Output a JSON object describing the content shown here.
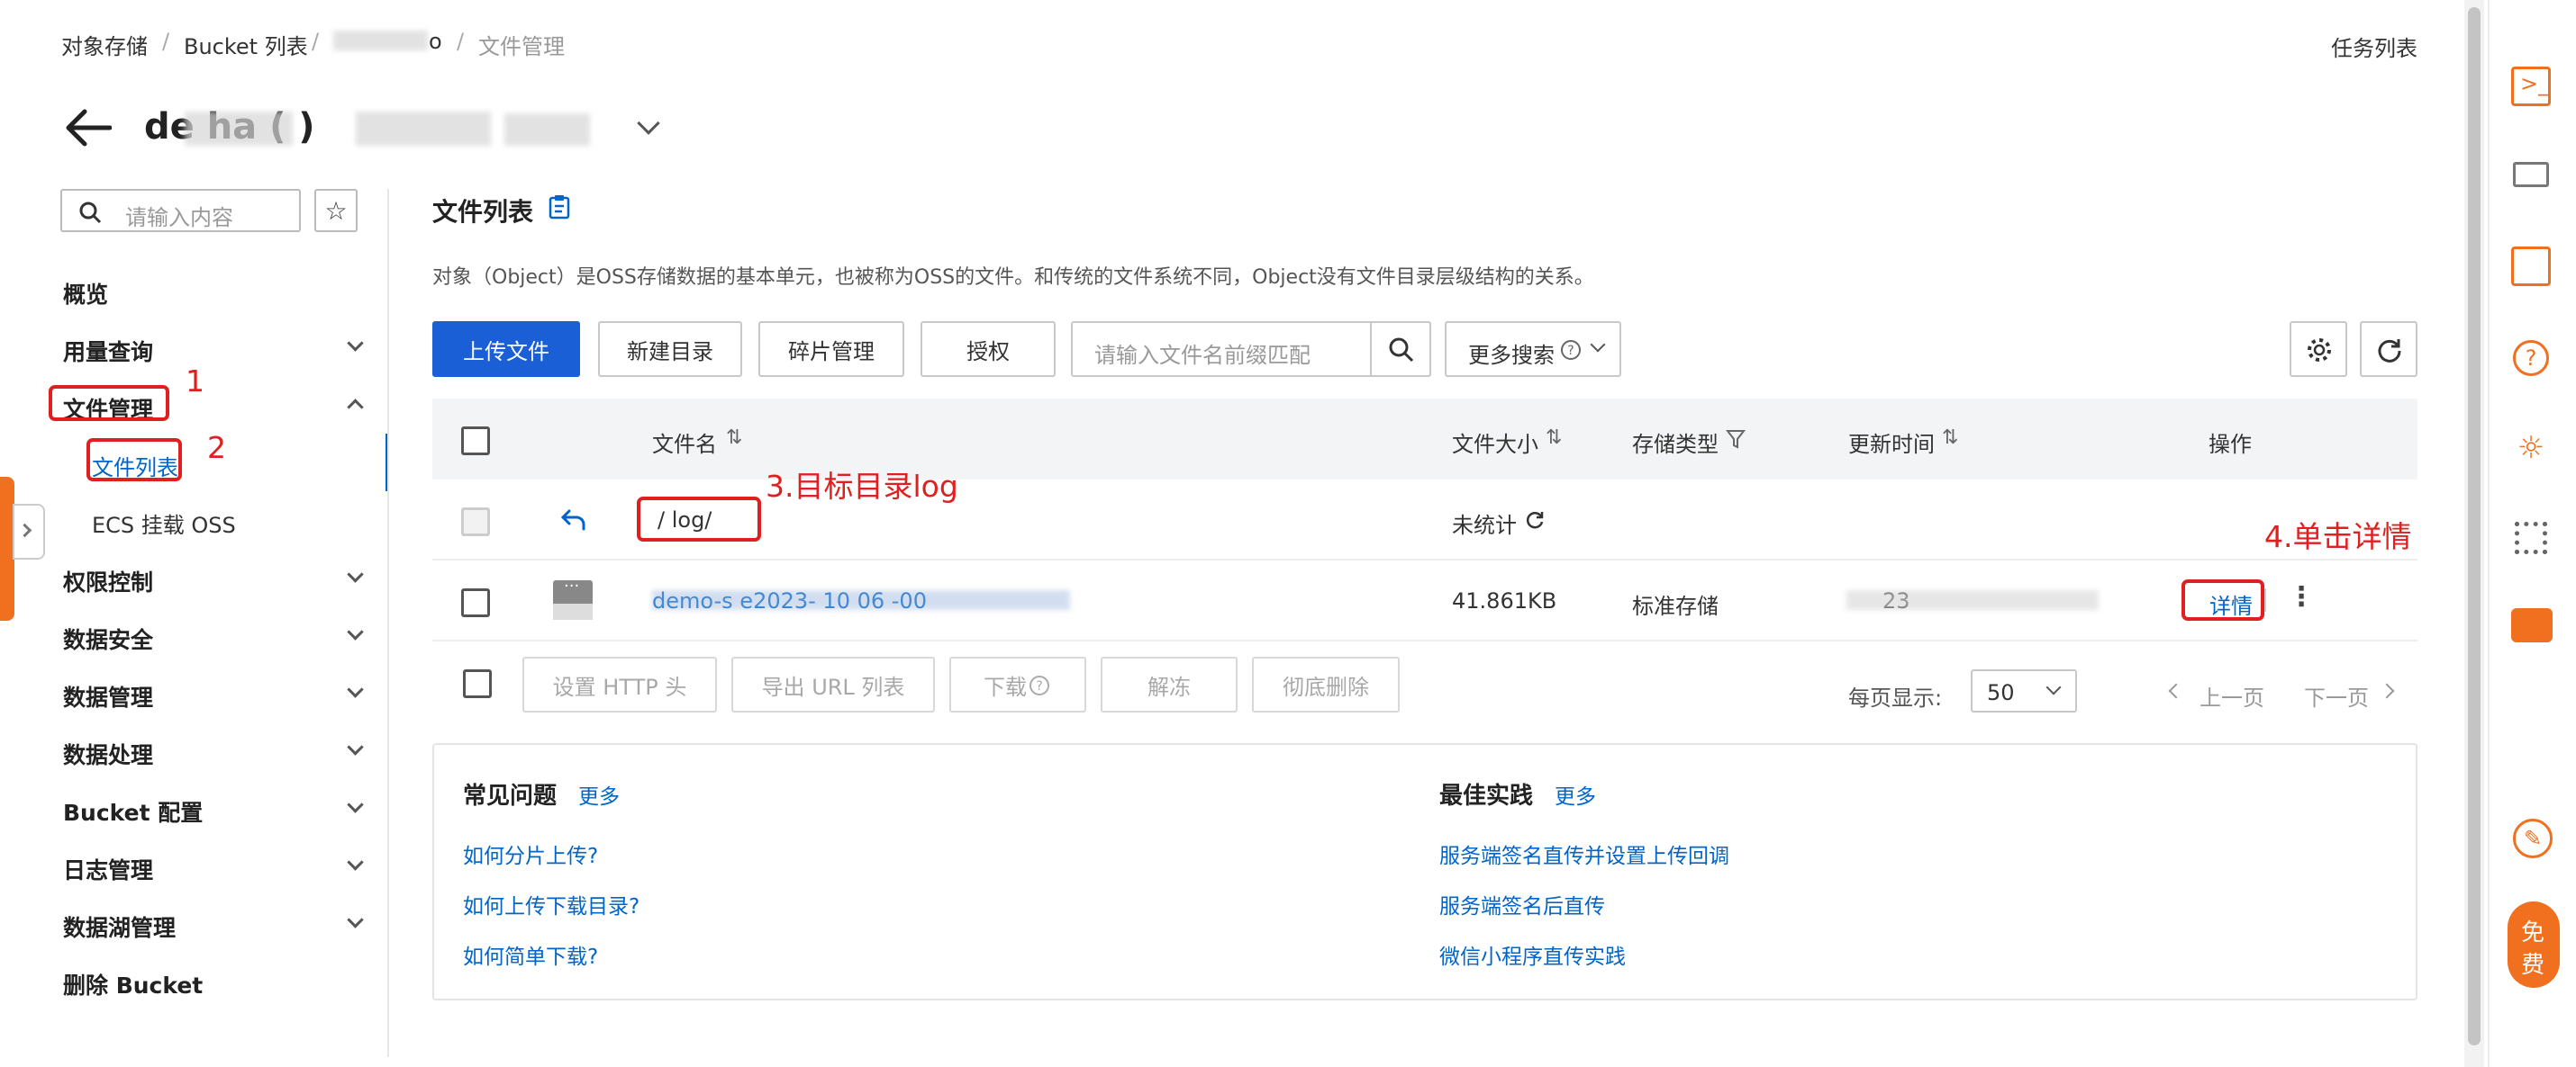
{
  "breadcrumb": {
    "item1": "对象存储",
    "sep": "/",
    "item2": "Bucket 列表",
    "item3": "o",
    "item4": "文件管理"
  },
  "task_list": "任务列表",
  "bucket_title": "de ha ( )",
  "sidebar": {
    "search_placeholder": "请输入内容",
    "items": [
      {
        "label": "概览"
      },
      {
        "label": "用量查询"
      },
      {
        "label": "文件管理"
      },
      {
        "label": "文件列表"
      },
      {
        "label": "ECS 挂载 OSS"
      },
      {
        "label": "权限控制"
      },
      {
        "label": "数据安全"
      },
      {
        "label": "数据管理"
      },
      {
        "label": "数据处理"
      },
      {
        "label": "Bucket 配置"
      },
      {
        "label": "日志管理"
      },
      {
        "label": "数据湖管理"
      },
      {
        "label": "删除 Bucket"
      }
    ]
  },
  "main": {
    "title": "文件列表",
    "description": "对象（Object）是OSS存储数据的基本单元，也被称为OSS的文件。和传统的文件系统不同，Object没有文件目录层级结构的关系。",
    "toolbar": {
      "upload": "上传文件",
      "new_dir": "新建目录",
      "fragment": "碎片管理",
      "authorize": "授权",
      "search_placeholder": "请输入文件名前缀匹配",
      "more_search": "更多搜索"
    },
    "table": {
      "headers": {
        "name": "文件名",
        "size": "文件大小",
        "storage": "存储类型",
        "updated": "更新时间",
        "actions": "操作"
      },
      "dir_row": {
        "name": "/  log/",
        "size": "未统计"
      },
      "file_row": {
        "name": "demo-s e2023- 10 06 -00",
        "size": "41.861KB",
        "storage": "标准存储",
        "updated": "23",
        "detail": "详情"
      }
    },
    "bulk": {
      "http_header": "设置 HTTP 头",
      "export_url": "导出 URL 列表",
      "download": "下载",
      "unfreeze": "解冻",
      "delete": "彻底删除"
    },
    "pager": {
      "label": "每页显示:",
      "size": "50",
      "prev": "上一页",
      "next": "下一页"
    },
    "faq": {
      "title": "常见问题",
      "more": "更多",
      "links": [
        "如何分片上传?",
        "如何上传下载目录?",
        "如何简单下载?"
      ]
    },
    "best": {
      "title": "最佳实践",
      "more": "更多",
      "links": [
        "服务端签名直传并设置上传回调",
        "服务端签名后直传",
        "微信小程序直传实践"
      ]
    }
  },
  "annotations": {
    "a1": "1",
    "a2": "2",
    "a3": "3.目标目录log",
    "a4": "4.单击详情"
  },
  "free_badge": {
    "l1": "免",
    "l2": "费"
  },
  "colors": {
    "primary": "#1a5fd6",
    "link": "#0064c8",
    "annotation": "#e02020",
    "orange": "#f07020"
  }
}
